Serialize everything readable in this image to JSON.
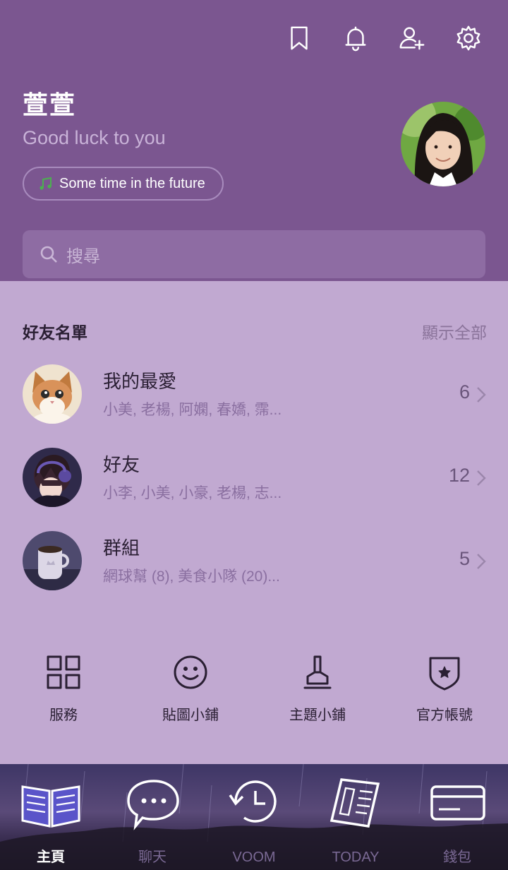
{
  "header": {
    "icons": [
      "bookmark-icon",
      "bell-icon",
      "add-friend-icon",
      "settings-icon"
    ],
    "profile_name": "萱萱",
    "status_message": "Good luck to you",
    "music": "Some time in the future",
    "search_placeholder": "搜尋"
  },
  "friends": {
    "title": "好友名單",
    "show_all": "顯示全部",
    "groups": [
      {
        "title": "我的最愛",
        "members": "小美, 老楊, 阿嫻, 春嬌, 霈...",
        "count": "6"
      },
      {
        "title": "好友",
        "members": "小李, 小美, 小豪, 老楊, 志...",
        "count": "12"
      },
      {
        "title": "群組",
        "members": "網球幫 (8), 美食小隊 (20)...",
        "count": "5"
      }
    ]
  },
  "services": [
    {
      "label": "服務",
      "icon": "grid-icon"
    },
    {
      "label": "貼圖小鋪",
      "icon": "smiley-icon"
    },
    {
      "label": "主題小鋪",
      "icon": "brush-icon"
    },
    {
      "label": "官方帳號",
      "icon": "shield-star-icon"
    }
  ],
  "nav": [
    {
      "label": "主頁",
      "icon": "book-icon",
      "active": true
    },
    {
      "label": "聊天",
      "icon": "chat-bubble-icon"
    },
    {
      "label": "VOOM",
      "icon": "clock-icon"
    },
    {
      "label": "TODAY",
      "icon": "newspaper-icon"
    },
    {
      "label": "錢包",
      "icon": "wallet-card-icon"
    }
  ],
  "colors": {
    "header_bg": "#7b5690",
    "body_bg": "#c1a9d1",
    "accent_green": "#4caf50"
  }
}
